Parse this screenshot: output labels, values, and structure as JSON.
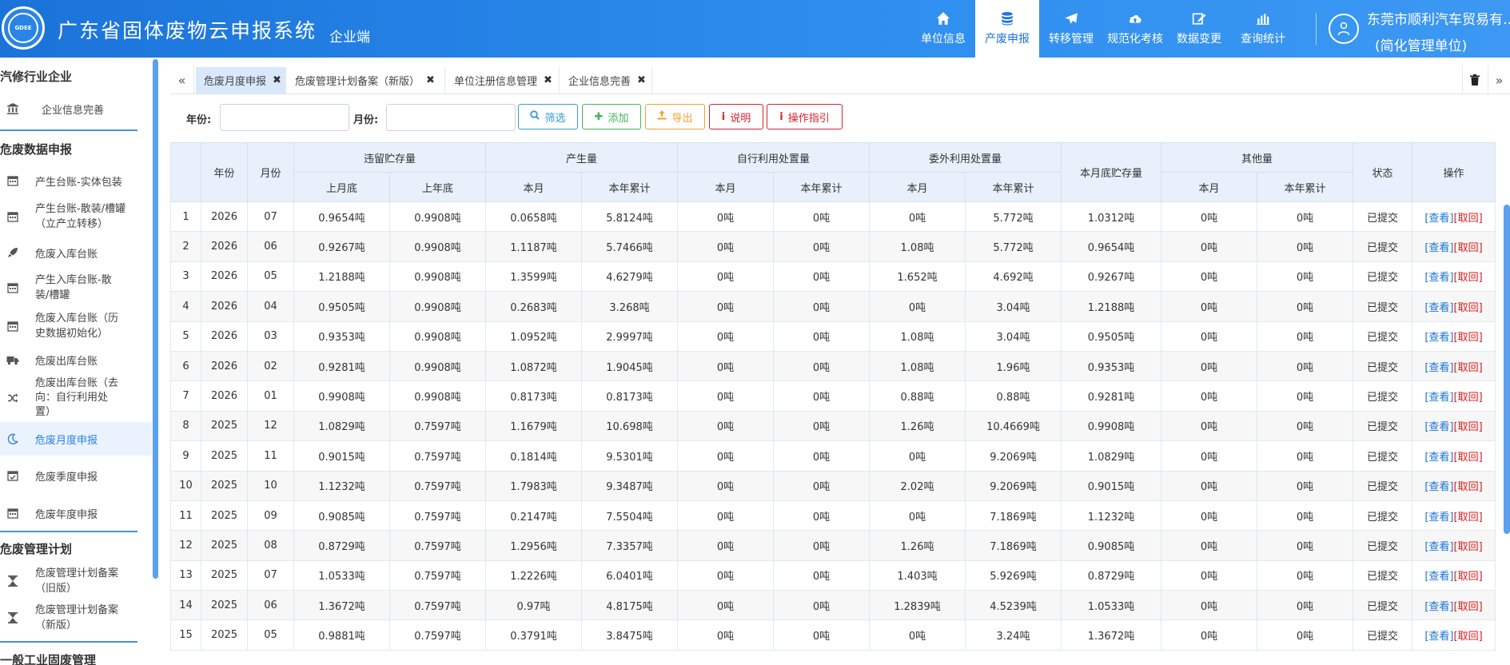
{
  "header": {
    "app_title": "广东省固体废物云申报系统",
    "app_subtitle": "企业端",
    "logo_text": "GDEE",
    "nav": [
      {
        "label": "单位信息",
        "icon": "home-icon",
        "active": false
      },
      {
        "label": "产废申报",
        "icon": "database-icon",
        "active": true
      },
      {
        "label": "转移管理",
        "icon": "plane-icon",
        "active": false
      },
      {
        "label": "规范化考核",
        "icon": "cloud-upload-icon",
        "active": false
      },
      {
        "label": "数据变更",
        "icon": "edit-icon",
        "active": false
      },
      {
        "label": "查询统计",
        "icon": "bar-chart-icon",
        "active": false
      }
    ],
    "user_name": "东莞市顺利汽车贸易有…",
    "user_type": "(简化管理单位)"
  },
  "sidebar": {
    "groups": [
      {
        "title": "汽修行业企业",
        "items": [
          {
            "label": "企业信息完善",
            "icon": "bank-icon"
          }
        ]
      },
      {
        "title": "危废数据申报",
        "items": [
          {
            "label": "产生台账-实体包装",
            "icon": "calendar-icon"
          },
          {
            "label": "产生台账-散装/槽罐（立产立转移）",
            "icon": "calendar-icon"
          },
          {
            "label": "危废入库台账",
            "icon": "rocket-icon"
          },
          {
            "label": "产生入库台账-散装/槽罐",
            "icon": "calendar-icon"
          },
          {
            "label": "危废入库台账（历史数据初始化）",
            "icon": "calendar-icon"
          },
          {
            "label": "危废出库台账",
            "icon": "truck-icon"
          },
          {
            "label": "危废出库台账（去向：自行利用处置）",
            "icon": "shuffle-icon"
          },
          {
            "label": "危废月度申报",
            "icon": "moon-icon",
            "active": true
          },
          {
            "label": "危废季度申报",
            "icon": "calendar-check-icon"
          },
          {
            "label": "危废年度申报",
            "icon": "calendar-icon"
          }
        ]
      },
      {
        "title": "危废管理计划",
        "items": [
          {
            "label": "危废管理计划备案（旧版）",
            "icon": "hourglass-icon"
          },
          {
            "label": "危废管理计划备案（新版）",
            "icon": "hourglass-icon"
          }
        ]
      },
      {
        "title": "一般工业固废管理",
        "items": []
      }
    ]
  },
  "tabs": [
    {
      "label": "危废月度申报",
      "active": true
    },
    {
      "label": "危废管理计划备案（新版）",
      "active": false
    },
    {
      "label": "单位注册信息管理",
      "active": false
    },
    {
      "label": "企业信息完善",
      "active": false
    }
  ],
  "filter": {
    "year_label": "年份:",
    "month_label": "月份:",
    "year_value": "",
    "month_value": "",
    "buttons": [
      {
        "label": "筛选",
        "icon": "search-icon",
        "color": "#3a9ad9"
      },
      {
        "label": "添加",
        "icon": "plus-icon",
        "color": "#43b55a"
      },
      {
        "label": "导出",
        "icon": "export-icon",
        "color": "#f0a030"
      },
      {
        "label": "说明",
        "icon": "info-icon",
        "color": "#d9232d"
      },
      {
        "label": "操作指引",
        "icon": "info-icon",
        "color": "#d9232d"
      }
    ]
  },
  "table": {
    "header_row1": [
      "年份",
      "月份",
      "违留贮存量",
      "产生量",
      "自行利用处置量",
      "委外利用处置量",
      "本月底贮存量",
      "其他量",
      "状态",
      "操作"
    ],
    "header_row2": [
      "上月底",
      "上年底",
      "本月",
      "本年累计",
      "本月",
      "本年累计",
      "本月",
      "本年累计",
      "本月",
      "本年累计"
    ],
    "view_label": "[查看]",
    "revoke_label": "[取回]",
    "rows": [
      [
        "1",
        "2026",
        "07",
        "0.9654吨",
        "0.9908吨",
        "0.0658吨",
        "5.8124吨",
        "0吨",
        "0吨",
        "0吨",
        "5.772吨",
        "1.0312吨",
        "0吨",
        "0吨",
        "已提交"
      ],
      [
        "2",
        "2026",
        "06",
        "0.9267吨",
        "0.9908吨",
        "1.1187吨",
        "5.7466吨",
        "0吨",
        "0吨",
        "1.08吨",
        "5.772吨",
        "0.9654吨",
        "0吨",
        "0吨",
        "已提交"
      ],
      [
        "3",
        "2026",
        "05",
        "1.2188吨",
        "0.9908吨",
        "1.3599吨",
        "4.6279吨",
        "0吨",
        "0吨",
        "1.652吨",
        "4.692吨",
        "0.9267吨",
        "0吨",
        "0吨",
        "已提交"
      ],
      [
        "4",
        "2026",
        "04",
        "0.9505吨",
        "0.9908吨",
        "0.2683吨",
        "3.268吨",
        "0吨",
        "0吨",
        "0吨",
        "3.04吨",
        "1.2188吨",
        "0吨",
        "0吨",
        "已提交"
      ],
      [
        "5",
        "2026",
        "03",
        "0.9353吨",
        "0.9908吨",
        "1.0952吨",
        "2.9997吨",
        "0吨",
        "0吨",
        "1.08吨",
        "3.04吨",
        "0.9505吨",
        "0吨",
        "0吨",
        "已提交"
      ],
      [
        "6",
        "2026",
        "02",
        "0.9281吨",
        "0.9908吨",
        "1.0872吨",
        "1.9045吨",
        "0吨",
        "0吨",
        "1.08吨",
        "1.96吨",
        "0.9353吨",
        "0吨",
        "0吨",
        "已提交"
      ],
      [
        "7",
        "2026",
        "01",
        "0.9908吨",
        "0.9908吨",
        "0.8173吨",
        "0.8173吨",
        "0吨",
        "0吨",
        "0.88吨",
        "0.88吨",
        "0.9281吨",
        "0吨",
        "0吨",
        "已提交"
      ],
      [
        "8",
        "2025",
        "12",
        "1.0829吨",
        "0.7597吨",
        "1.1679吨",
        "10.698吨",
        "0吨",
        "0吨",
        "1.26吨",
        "10.4669吨",
        "0.9908吨",
        "0吨",
        "0吨",
        "已提交"
      ],
      [
        "9",
        "2025",
        "11",
        "0.9015吨",
        "0.7597吨",
        "0.1814吨",
        "9.5301吨",
        "0吨",
        "0吨",
        "0吨",
        "9.2069吨",
        "1.0829吨",
        "0吨",
        "0吨",
        "已提交"
      ],
      [
        "10",
        "2025",
        "10",
        "1.1232吨",
        "0.7597吨",
        "1.7983吨",
        "9.3487吨",
        "0吨",
        "0吨",
        "2.02吨",
        "9.2069吨",
        "0.9015吨",
        "0吨",
        "0吨",
        "已提交"
      ],
      [
        "11",
        "2025",
        "09",
        "0.9085吨",
        "0.7597吨",
        "0.2147吨",
        "7.5504吨",
        "0吨",
        "0吨",
        "0吨",
        "7.1869吨",
        "1.1232吨",
        "0吨",
        "0吨",
        "已提交"
      ],
      [
        "12",
        "2025",
        "08",
        "0.8729吨",
        "0.7597吨",
        "1.2956吨",
        "7.3357吨",
        "0吨",
        "0吨",
        "1.26吨",
        "7.1869吨",
        "0.9085吨",
        "0吨",
        "0吨",
        "已提交"
      ],
      [
        "13",
        "2025",
        "07",
        "1.0533吨",
        "0.7597吨",
        "1.2226吨",
        "6.0401吨",
        "0吨",
        "0吨",
        "1.403吨",
        "5.9269吨",
        "0.8729吨",
        "0吨",
        "0吨",
        "已提交"
      ],
      [
        "14",
        "2025",
        "06",
        "1.3672吨",
        "0.7597吨",
        "0.97吨",
        "4.8175吨",
        "0吨",
        "0吨",
        "1.2839吨",
        "4.5239吨",
        "1.0533吨",
        "0吨",
        "0吨",
        "已提交"
      ],
      [
        "15",
        "2025",
        "05",
        "0.9881吨",
        "0.7597吨",
        "0.3791吨",
        "3.8475吨",
        "0吨",
        "0吨",
        "0吨",
        "3.24吨",
        "1.3672吨",
        "0吨",
        "0吨",
        "已提交"
      ]
    ]
  }
}
